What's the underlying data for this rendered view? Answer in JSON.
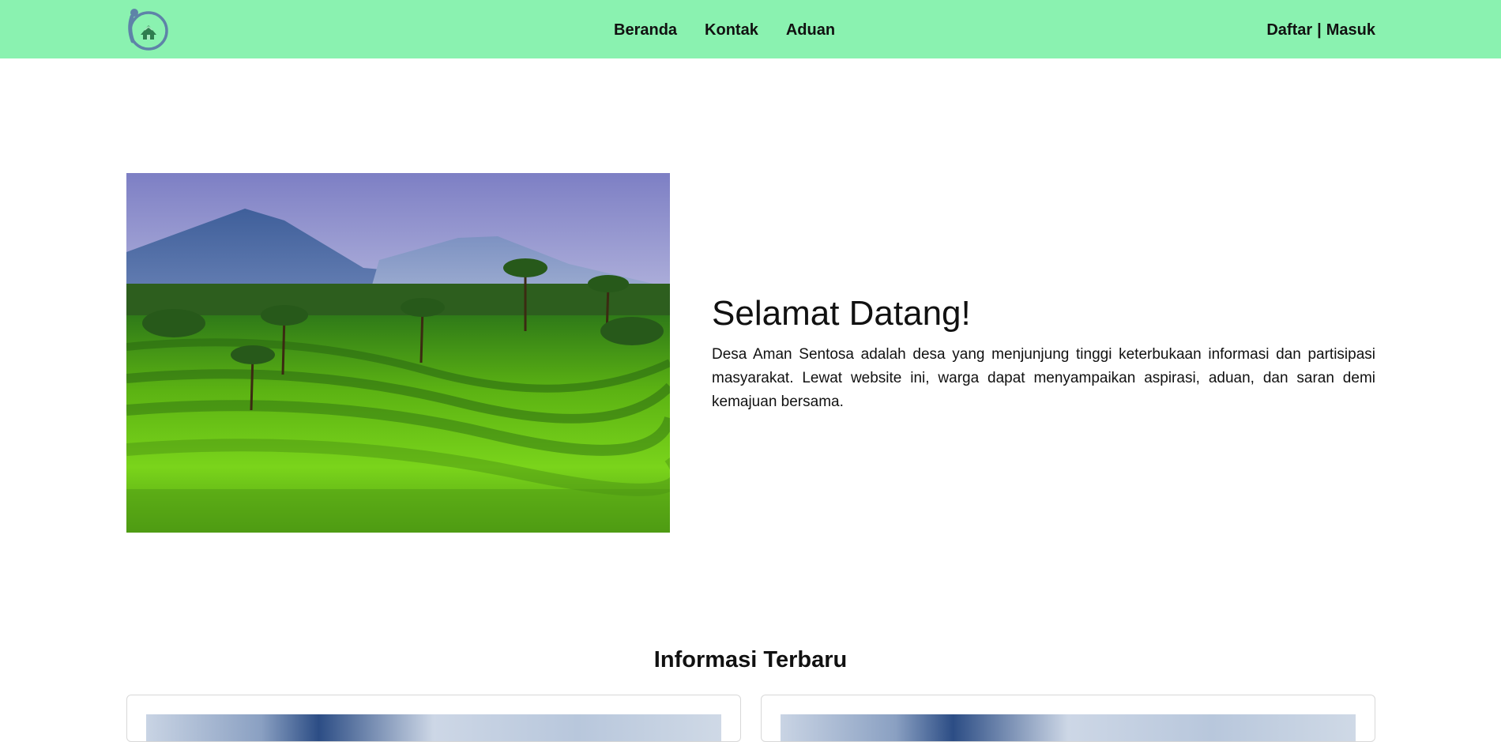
{
  "navbar": {
    "logo_icon": "village-logo-icon",
    "links": [
      {
        "label": "Beranda"
      },
      {
        "label": "Kontak"
      },
      {
        "label": "Aduan"
      }
    ],
    "auth": {
      "register_label": "Daftar",
      "separator": "|",
      "login_label": "Masuk"
    },
    "background_color": "#8af2b0"
  },
  "hero": {
    "image_description_icon": "rice-terrace-landscape-image",
    "title": "Selamat Datang!",
    "description": "Desa Aman Sentosa adalah desa yang menjunjung tinggi keterbukaan informasi dan partisipasi masyarakat. Lewat website ini, warga dapat menyampaikan aspirasi, aduan, dan saran demi kemajuan bersama."
  },
  "news": {
    "title": "Informasi Terbaru"
  }
}
